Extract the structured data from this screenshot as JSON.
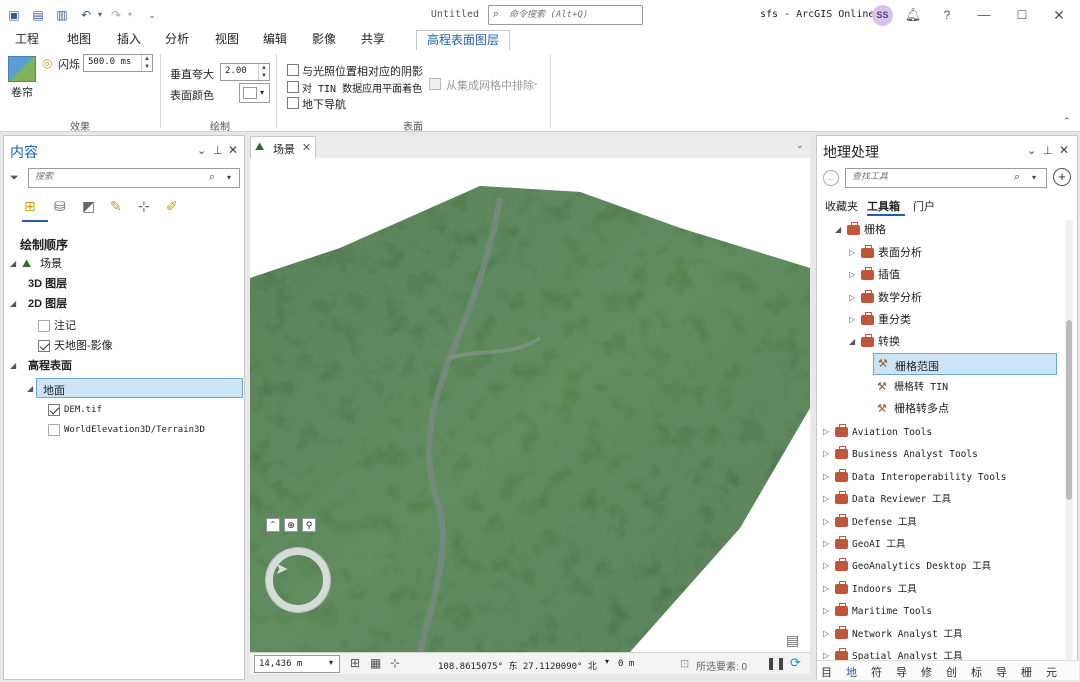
{
  "title_bar": {
    "doc_title": "Untitled",
    "search_placeholder": "命令搜索 (Alt+Q)",
    "project": "sfs - ArcGIS Online",
    "avatar": "SS",
    "help": "?"
  },
  "ribbon_tabs": [
    "工程",
    "地图",
    "插入",
    "分析",
    "视图",
    "编辑",
    "影像",
    "共享",
    "高程表面图层"
  ],
  "ribbon": {
    "effects": {
      "swipe_label": "卷帘",
      "flicker_label": "闪烁",
      "flicker_value": "500.0  ms",
      "group_label": "效果"
    },
    "drawing": {
      "exaggeration_label": "垂直夸大",
      "exaggeration_value": "2.00",
      "surface_color_label": "表面颜色",
      "group_label": "绘制"
    },
    "surface": {
      "shadow_label": "与光照位置相对应的阴影",
      "tin_shading_label": "对 TIN 数据应用平面着色",
      "underground_label": "地下导航",
      "exclude_label": "从集成网格中排除",
      "group_label": "表面"
    }
  },
  "contents": {
    "title": "内容",
    "search_placeholder": "搜索",
    "draw_order": "绘制顺序",
    "items": {
      "scene": "场景",
      "layers3d": "3D 图层",
      "layers2d": "2D 图层",
      "notes": "注记",
      "tianditu": "天地图-影像",
      "elev": "高程表面",
      "ground": "地面",
      "dem": "DEM.tif",
      "world": "WorldElevation3D/Terrain3D"
    }
  },
  "map": {
    "tab_label": "场景",
    "scale": "14,436 m",
    "coords": "108.8615075° 东  27.1120090° 北",
    "elev": "0 m",
    "selected": "所选要素: 0"
  },
  "geoprocessing": {
    "title": "地理处理",
    "search_placeholder": "查找工具",
    "tabs": [
      "收藏夹",
      "工具箱",
      "门户"
    ],
    "raster": "栅格",
    "raster_children": [
      "表面分析",
      "插值",
      "数学分析",
      "重分类",
      "转换"
    ],
    "conversion_tools": [
      "栅格范围",
      "栅格转 TIN",
      "栅格转多点"
    ],
    "toolboxes": [
      "Aviation Tools",
      "Business Analyst Tools",
      "Data Interoperability Tools",
      "Data Reviewer 工具",
      "Defense 工具",
      "GeoAI 工具",
      "GeoAnalytics Desktop 工具",
      "Indoors 工具",
      "Maritime Tools",
      "Network Analyst 工具",
      "Spatial Analyst 工具"
    ],
    "bottom_tabs": [
      "目",
      "地",
      "符",
      "导",
      "修",
      "创",
      "标",
      "导",
      "栅",
      "元"
    ]
  },
  "colors": {
    "accent": "#1f5fa8",
    "selection": "#cce4f7",
    "toolbox": "#c0553a"
  }
}
